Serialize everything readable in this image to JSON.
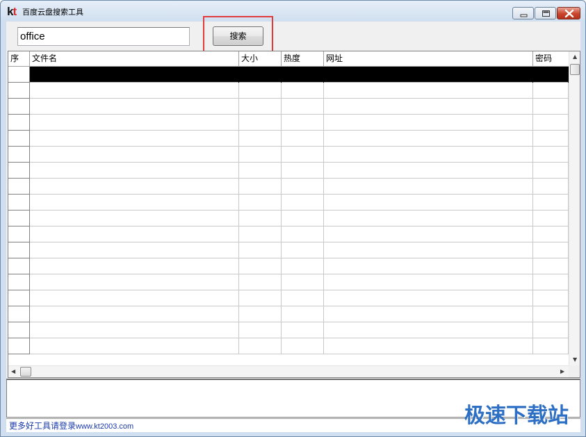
{
  "window": {
    "title": "百度云盘搜索工具",
    "logo_k": "k",
    "logo_t": "t"
  },
  "search": {
    "value": "office",
    "button_label": "搜索"
  },
  "table": {
    "columns": [
      {
        "key": "index",
        "label": "序"
      },
      {
        "key": "filename",
        "label": "文件名"
      },
      {
        "key": "size",
        "label": "大小"
      },
      {
        "key": "heat",
        "label": "热度"
      },
      {
        "key": "url",
        "label": "网址"
      },
      {
        "key": "password",
        "label": "密码"
      }
    ],
    "row_count": 18,
    "selected_row": 0
  },
  "status": {
    "link_text": "更多好工具请登录",
    "link_url": "www.kt2003.com"
  },
  "watermark": "极速下载站",
  "colors": {
    "highlight": "#e03a3a",
    "link": "#1a3aa8",
    "watermark": "#2d6fc4"
  }
}
